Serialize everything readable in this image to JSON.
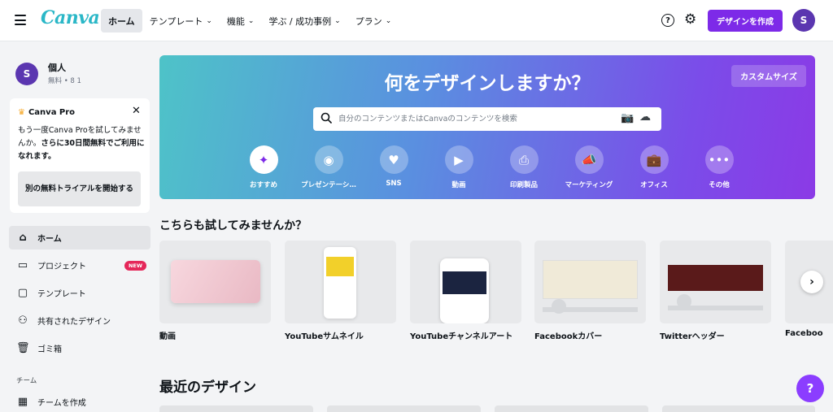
{
  "app": {
    "logo": "Canva"
  },
  "nav": {
    "items": [
      {
        "label": "ホーム",
        "active": true,
        "dropdown": false
      },
      {
        "label": "テンプレート",
        "active": false,
        "dropdown": true
      },
      {
        "label": "機能",
        "active": false,
        "dropdown": true
      },
      {
        "label": "学ぶ / 成功事例",
        "active": false,
        "dropdown": true
      },
      {
        "label": "プラン",
        "active": false,
        "dropdown": true
      }
    ],
    "help": "?",
    "create_button": "デザインを作成",
    "avatar_initial": "S"
  },
  "sidebar": {
    "user": {
      "initial": "S",
      "name": "個人",
      "sub": "無料 • 8 1"
    },
    "pro_card": {
      "title": "Canva Pro",
      "text_plain": "もう一度Canva Proを試してみませんか。",
      "text_bold": "さらに30日間無料でご利用になれます。",
      "button": "別の無料トライアルを開始する"
    },
    "items": [
      {
        "label": "ホーム",
        "icon": "home-icon",
        "glyph": "⌂",
        "active": true
      },
      {
        "label": "プロジェクト",
        "icon": "folder-icon",
        "glyph": "▭",
        "badge": "NEW"
      },
      {
        "label": "テンプレート",
        "icon": "template-icon",
        "glyph": "▢"
      },
      {
        "label": "共有されたデザイン",
        "icon": "shared-icon",
        "glyph": "⚇"
      },
      {
        "label": "ゴミ箱",
        "icon": "trash-icon",
        "glyph": "🗑"
      }
    ],
    "team_label": "チーム",
    "team_item": "チームを作成"
  },
  "hero": {
    "title": "何をデザインしますか？",
    "custom_size": "カスタムサイズ",
    "search_placeholder": "自分のコンテンツまたはCanvaのコンテンツを検索",
    "categories": [
      {
        "label": "おすすめ",
        "icon": "sparkle-icon",
        "glyph": "✦",
        "active": true
      },
      {
        "label": "プレゼンテーシ…",
        "icon": "presentation-icon",
        "glyph": "◉"
      },
      {
        "label": "SNS",
        "icon": "heart-chat-icon",
        "glyph": "♥"
      },
      {
        "label": "動画",
        "icon": "video-icon",
        "glyph": "▶"
      },
      {
        "label": "印刷製品",
        "icon": "printer-icon",
        "glyph": "⎙"
      },
      {
        "label": "マーケティング",
        "icon": "megaphone-icon",
        "glyph": "📣"
      },
      {
        "label": "オフィス",
        "icon": "briefcase-icon",
        "glyph": "💼"
      },
      {
        "label": "その他",
        "icon": "more-icon",
        "glyph": "•••"
      }
    ]
  },
  "suggest": {
    "title": "こちらも試してみませんか？",
    "cards": [
      {
        "label": "動画"
      },
      {
        "label": "YouTubeサムネイル"
      },
      {
        "label": "YouTubeチャンネルアート"
      },
      {
        "label": "Facebookカバー"
      },
      {
        "label": "Twitterヘッダー"
      },
      {
        "label": "Faceboo"
      }
    ]
  },
  "recent": {
    "title": "最近のデザイン"
  },
  "help_fab": "?",
  "colors": {
    "accent": "#7d2ae8",
    "logo": "#2ab7c7",
    "badge_new": "#e5275a"
  }
}
